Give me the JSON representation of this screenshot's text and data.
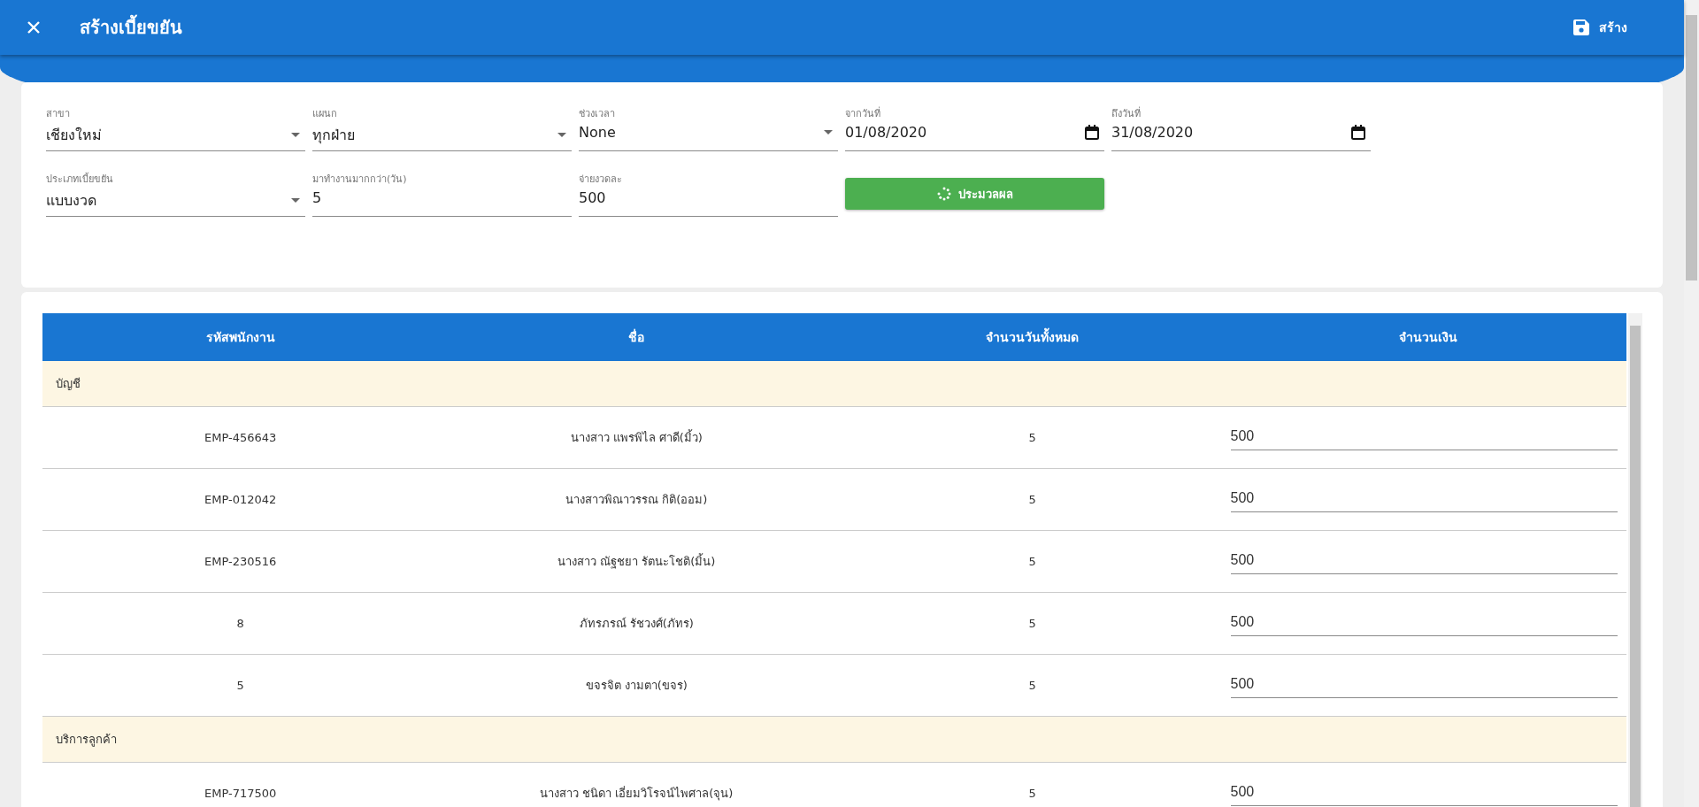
{
  "app_bar": {
    "title": "สร้างเบี้ยขยัน",
    "action": "สร้าง"
  },
  "form": {
    "fields": [
      {
        "kind": "select",
        "label": "สาขา",
        "value": "เชียงใหม่"
      },
      {
        "kind": "select",
        "label": "แผนก",
        "value": "ทุกฝ่าย"
      },
      {
        "kind": "select",
        "label": "ช่วงเวลา",
        "value": "None"
      },
      {
        "kind": "date",
        "label": "จากวันที่",
        "value": "01/08/2020"
      },
      {
        "kind": "date",
        "label": "ถึงวันที่",
        "value": "31/08/2020"
      },
      {
        "kind": "select",
        "label": "ประเภทเบี้ยขยัน",
        "value": "แบบงวด"
      },
      {
        "kind": "text",
        "label": "มาทำงานมากกว่า(วัน)",
        "value": "5"
      },
      {
        "kind": "text",
        "label": "จ่ายงวดละ",
        "value": "500"
      },
      {
        "kind": "button",
        "label": "ประมวลผล"
      }
    ]
  },
  "table": {
    "columns": [
      "รหัสพนักงาน",
      "ชื่อ",
      "จำนวนวันทั้งหมด",
      "จำนวนเงิน"
    ],
    "rows": [
      {
        "kind": "group",
        "label": "บัญชี"
      },
      {
        "kind": "employee",
        "id": "EMP-456643",
        "name": "นางสาว แพรพิไล ศาดี(มิ้ว)",
        "days": "5",
        "amount": "500"
      },
      {
        "kind": "employee",
        "id": "EMP-012042",
        "name": "นางสาวพิณาวรรณ กิติ(ออม)",
        "days": "5",
        "amount": "500"
      },
      {
        "kind": "employee",
        "id": "EMP-230516",
        "name": "นางสาว ณัฐชยา รัตนะโชติ(มิ้น)",
        "days": "5",
        "amount": "500"
      },
      {
        "kind": "employee",
        "id": "8",
        "name": "ภัทรภรณ์ รัชวงศ์(ภัทร)",
        "days": "5",
        "amount": "500"
      },
      {
        "kind": "employee",
        "id": "5",
        "name": "ขจรจิต งามตา(ขจร)",
        "days": "5",
        "amount": "500"
      },
      {
        "kind": "group",
        "label": "บริการลูกค้า"
      },
      {
        "kind": "employee",
        "id": "EMP-717500",
        "name": "นางสาว ชนิดา เอี่ยมวิโรจน์ไพศาล(จุน)",
        "days": "5",
        "amount": "500"
      }
    ]
  }
}
